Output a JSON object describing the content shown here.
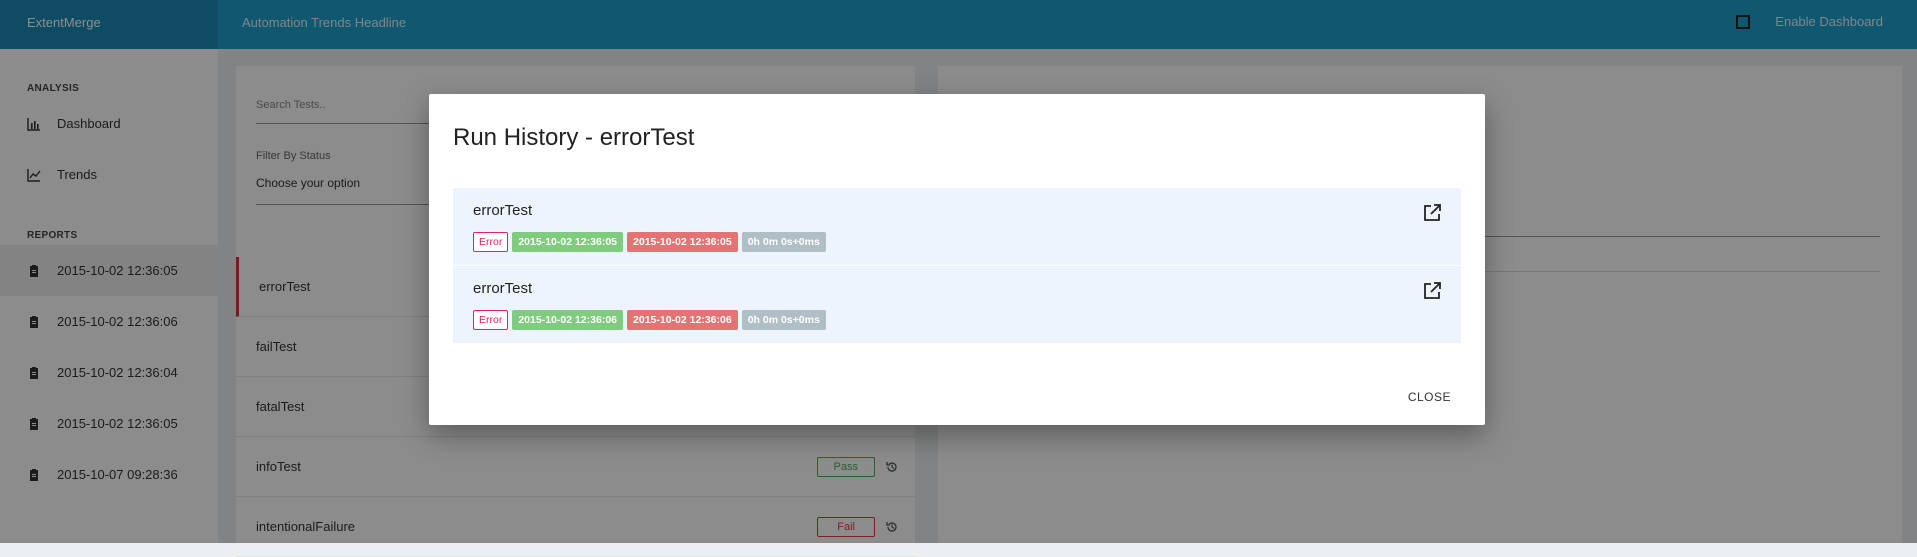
{
  "app": {
    "brand": "ExtentMerge",
    "headline": "Automation Trends Headline",
    "enable_dashboard": "Enable Dashboard"
  },
  "sidebar": {
    "analysis_heading": "ANALYSIS",
    "analysis_items": [
      {
        "label": "Dashboard",
        "icon": "bar-chart-icon"
      },
      {
        "label": "Trends",
        "icon": "line-chart-icon"
      }
    ],
    "reports_heading": "REPORTS",
    "reports": [
      {
        "label": "2015-10-02 12:36:05",
        "icon": "clipboard-icon"
      },
      {
        "label": "2015-10-02 12:36:06",
        "icon": "clipboard-icon"
      },
      {
        "label": "2015-10-02 12:36:04",
        "icon": "clipboard-icon"
      },
      {
        "label": "2015-10-02 12:36:05",
        "icon": "clipboard-icon"
      },
      {
        "label": "2015-10-07 09:28:36",
        "icon": "clipboard-icon"
      }
    ]
  },
  "filters": {
    "search_placeholder": "Search Tests..",
    "filter_label": "Filter By Status",
    "filter_value": "Choose your option"
  },
  "tests": [
    {
      "name": "errorTest",
      "status": ""
    },
    {
      "name": "failTest",
      "status": ""
    },
    {
      "name": "fatalTest",
      "status": ""
    },
    {
      "name": "infoTest",
      "status": "Pass"
    },
    {
      "name": "intentionalFailure",
      "status": "Fail"
    }
  ],
  "colors": {
    "accent": "#1e9ecc",
    "pass": "#4caf50",
    "fail": "#e53935",
    "error": "#e91e63"
  },
  "modal": {
    "title": "Run History - errorTest",
    "close_label": "CLOSE",
    "runs": [
      {
        "name": "errorTest",
        "status": "Error",
        "start": "2015-10-02 12:36:05",
        "end": "2015-10-02 12:36:05",
        "duration": "0h 0m 0s+0ms"
      },
      {
        "name": "errorTest",
        "status": "Error",
        "start": "2015-10-02 12:36:06",
        "end": "2015-10-02 12:36:06",
        "duration": "0h 0m 0s+0ms"
      }
    ]
  }
}
